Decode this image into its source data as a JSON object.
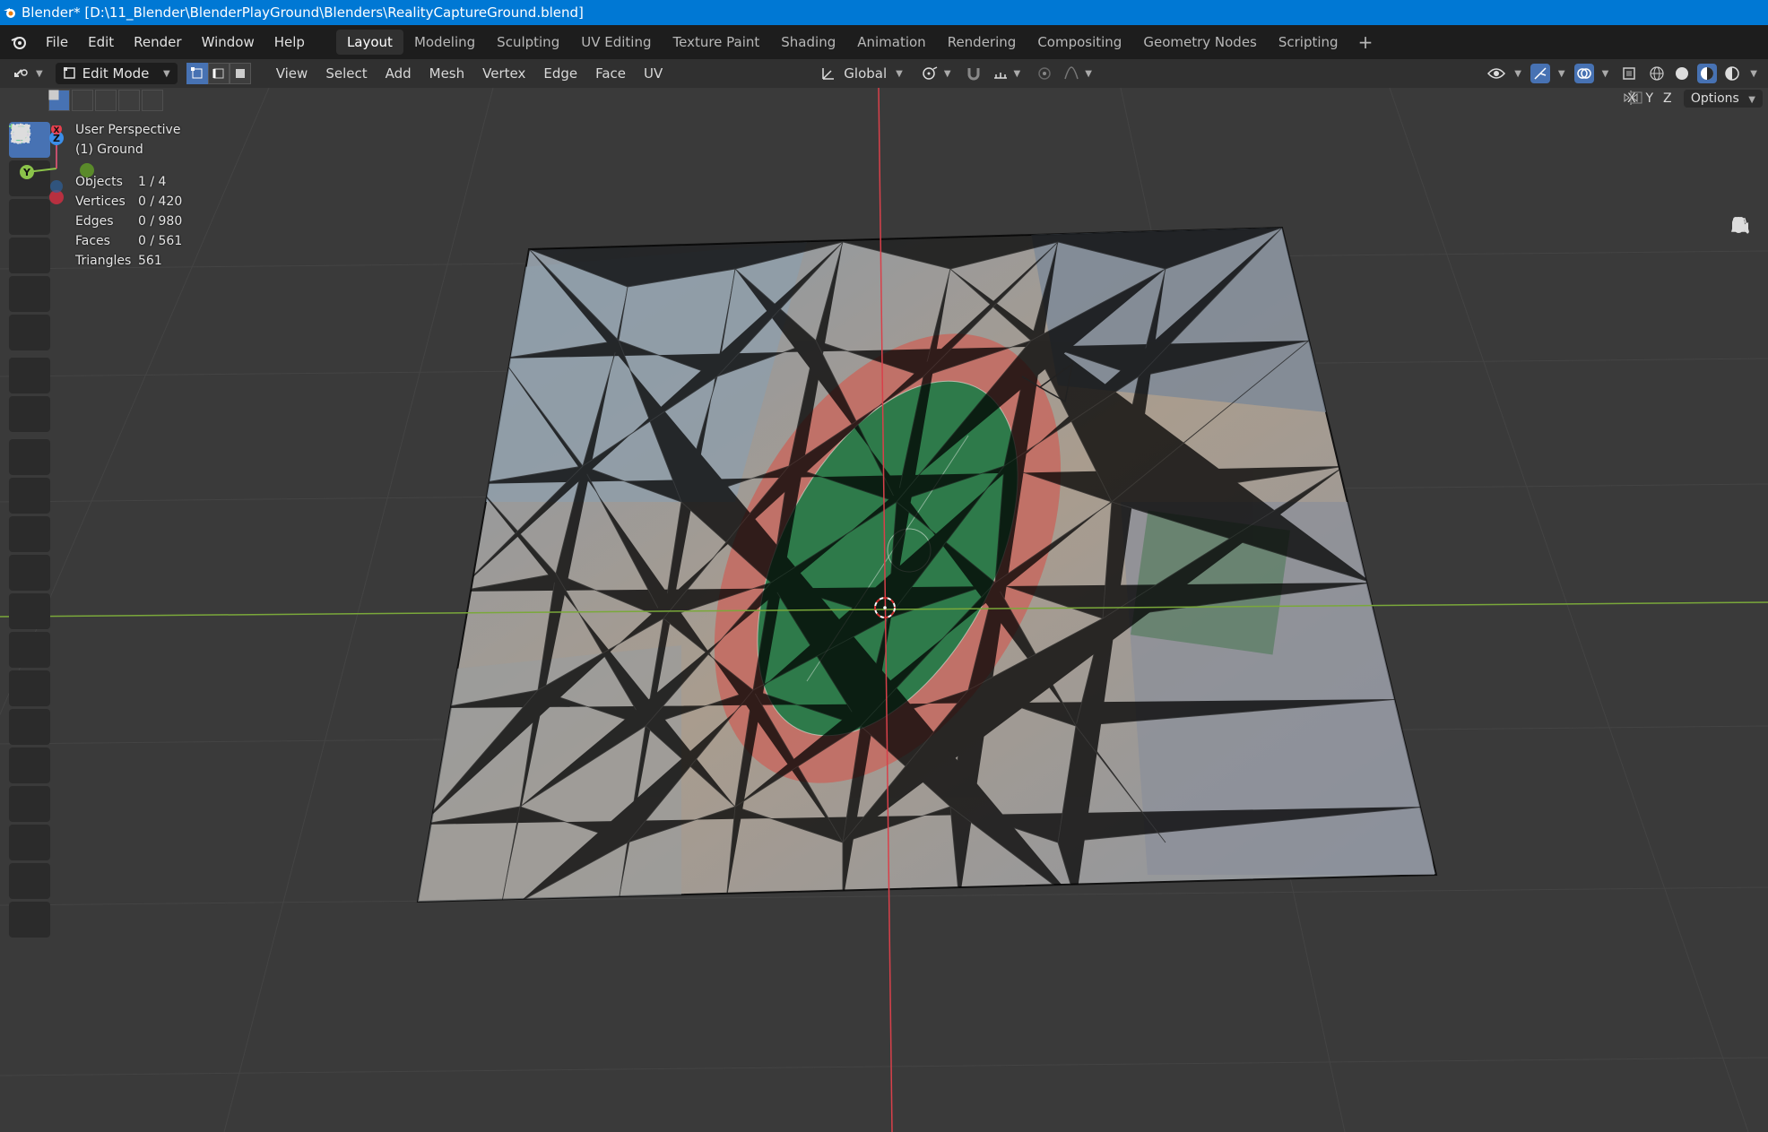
{
  "window": {
    "title": "Blender* [D:\\11_Blender\\BlenderPlayGround\\Blenders\\RealityCaptureGround.blend]"
  },
  "menu": {
    "items": [
      "File",
      "Edit",
      "Render",
      "Window",
      "Help"
    ]
  },
  "workspaces": {
    "tabs": [
      "Layout",
      "Modeling",
      "Sculpting",
      "UV Editing",
      "Texture Paint",
      "Shading",
      "Animation",
      "Rendering",
      "Compositing",
      "Geometry Nodes",
      "Scripting"
    ],
    "active": "Layout",
    "add_label": "+"
  },
  "header": {
    "mode": "Edit Mode",
    "menus": [
      "View",
      "Select",
      "Add",
      "Mesh",
      "Vertex",
      "Edge",
      "Face",
      "UV"
    ],
    "transform_orientation": "Global"
  },
  "viewport": {
    "view_name": "User Perspective",
    "object_name": "(1) Ground",
    "options_label": "Options",
    "axis_x": "X",
    "axis_y": "Y",
    "axis_z": "Z",
    "stats": [
      {
        "label": "Objects",
        "value": "1 / 4"
      },
      {
        "label": "Vertices",
        "value": "0 / 420"
      },
      {
        "label": "Edges",
        "value": "0 / 980"
      },
      {
        "label": "Faces",
        "value": "0 / 561"
      },
      {
        "label": "Triangles",
        "value": "561"
      }
    ],
    "gizmo": {
      "x": "X",
      "y": "Y",
      "z": "Z"
    }
  },
  "colors": {
    "title_bar": "#0078d4",
    "accent": "#4772b3",
    "axis_x": "#e8404e",
    "axis_y": "#8bc34a",
    "axis_z": "#3b8ee8",
    "field_green": "#2e7a4a",
    "track": "#c56a60"
  }
}
